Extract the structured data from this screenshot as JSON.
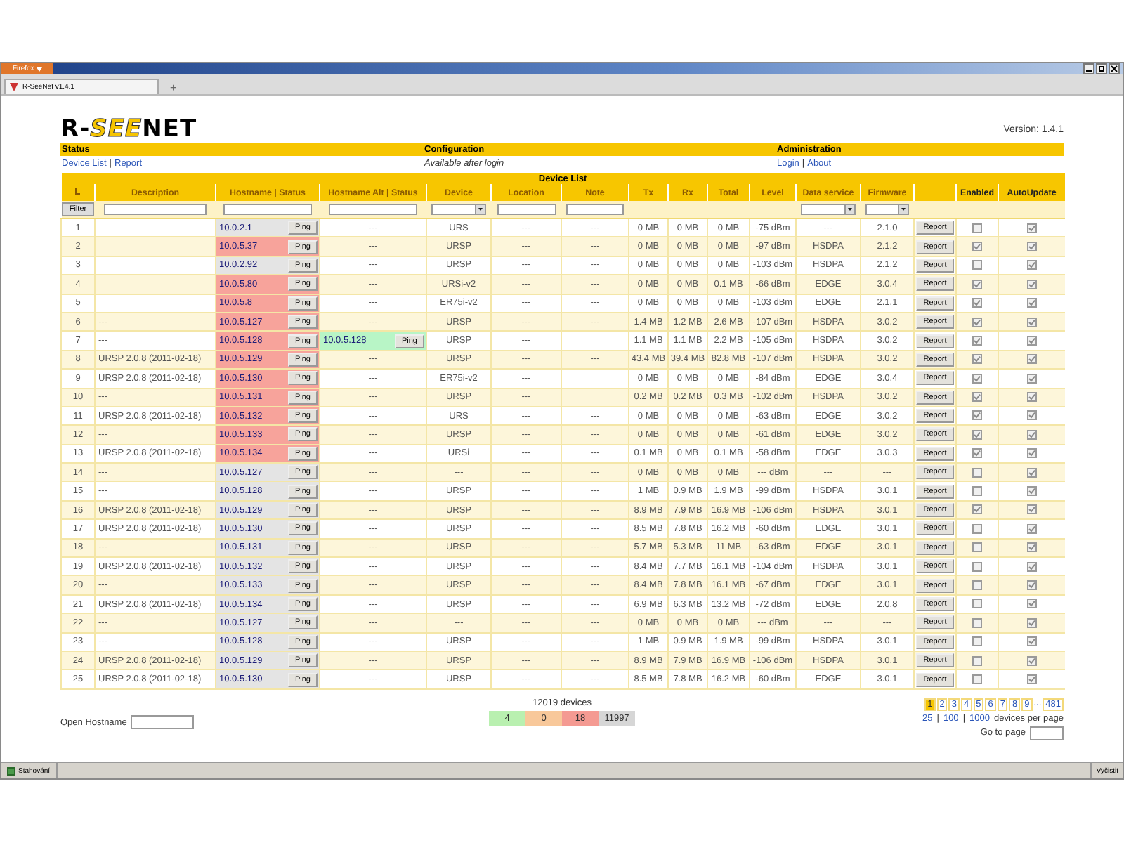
{
  "browser": {
    "menu_button": "Firefox",
    "tab_title": "R-SeeNet v1.4.1",
    "new_tab": "+"
  },
  "logo": {
    "prefix": "R-",
    "highlight": "SEE",
    "suffix": "NET"
  },
  "version": "Version: 1.4.1",
  "sections": [
    {
      "title": "Status",
      "links": [
        "Device List",
        "Report"
      ],
      "separators": [
        "|"
      ]
    },
    {
      "title": "Configuration",
      "note": "Available after login"
    },
    {
      "title": "Administration",
      "links": [
        "Login",
        "About"
      ],
      "separators": [
        "|"
      ]
    }
  ],
  "table_title": "Device List",
  "columns": [
    {
      "kind": "sort"
    },
    {
      "label": "Description"
    },
    {
      "label": "Hostname | Status"
    },
    {
      "label": "Hostname Alt | Status"
    },
    {
      "label": "Device"
    },
    {
      "label": "Location"
    },
    {
      "label": "Note"
    },
    {
      "label": "Tx"
    },
    {
      "label": "Rx"
    },
    {
      "label": "Total"
    },
    {
      "label": "Level"
    },
    {
      "label": "Data service"
    },
    {
      "label": "Firmware"
    },
    {
      "kind": "blank"
    },
    {
      "label": "Enabled"
    },
    {
      "label": "AutoUpdate"
    }
  ],
  "filters": [
    {
      "kind": "button",
      "label": "Filter"
    },
    {
      "kind": "input"
    },
    {
      "kind": "input"
    },
    {
      "kind": "input"
    },
    {
      "kind": "select"
    },
    {
      "kind": "input"
    },
    {
      "kind": "input"
    },
    {
      "kind": "empty"
    },
    {
      "kind": "empty"
    },
    {
      "kind": "empty"
    },
    {
      "kind": "empty"
    },
    {
      "kind": "select"
    },
    {
      "kind": "select"
    },
    {
      "kind": "empty"
    },
    {
      "kind": "empty"
    },
    {
      "kind": "empty"
    }
  ],
  "rows": [
    {
      "n": "1",
      "host": {
        "address": "10.0.2.1",
        "color": "#e4e4e4",
        "ping": "Ping"
      },
      "alt": {
        "text": "---"
      },
      "device": "URS",
      "location": "---",
      "note": "---",
      "tx": "0 MB",
      "rx": "0 MB",
      "total": "0 MB",
      "signal": "-75 dBm",
      "data_service": "---",
      "firmware": "2.1.0",
      "report": "Report",
      "enabled": false,
      "autoupdate": true
    },
    {
      "n": "2",
      "host": {
        "address": "10.0.5.37",
        "color": "#f7a39b",
        "ping": "Ping"
      },
      "alt": {
        "text": "---"
      },
      "device": "URSP",
      "location": "---",
      "note": "---",
      "tx": "0 MB",
      "rx": "0 MB",
      "total": "0 MB",
      "signal": "-97 dBm",
      "data_service": "HSDPA",
      "firmware": "2.1.2",
      "report": "Report",
      "enabled": true,
      "autoupdate": true
    },
    {
      "n": "3",
      "host": {
        "address": "10.0.2.92",
        "color": "#e4e4e4",
        "ping": "Ping"
      },
      "alt": {
        "text": "---"
      },
      "device": "URSP",
      "location": "---",
      "note": "---",
      "tx": "0 MB",
      "rx": "0 MB",
      "total": "0 MB",
      "signal": "-103 dBm",
      "data_service": "HSDPA",
      "firmware": "2.1.2",
      "report": "Report",
      "enabled": false,
      "autoupdate": true
    },
    {
      "n": "4",
      "host": {
        "address": "10.0.5.80",
        "color": "#f7a39b",
        "ping": "Ping"
      },
      "alt": {
        "text": "---"
      },
      "device": "URSi-v2",
      "location": "---",
      "note": "---",
      "tx": "0 MB",
      "rx": "0 MB",
      "total": "0.1 MB",
      "signal": "-66 dBm",
      "data_service": "EDGE",
      "firmware": "3.0.4",
      "report": "Report",
      "enabled": true,
      "autoupdate": true
    },
    {
      "n": "5",
      "host": {
        "address": "10.0.5.8",
        "color": "#f7a39b",
        "ping": "Ping"
      },
      "alt": {
        "text": "---"
      },
      "device": "ER75i-v2",
      "location": "---",
      "note": "---",
      "tx": "0 MB",
      "rx": "0 MB",
      "total": "0 MB",
      "signal": "-103 dBm",
      "data_service": "EDGE",
      "firmware": "2.1.1",
      "report": "Report",
      "enabled": true,
      "autoupdate": true
    },
    {
      "n": "6",
      "description": "---",
      "host": {
        "address": "10.0.5.127",
        "color": "#f7a39b",
        "ping": "Ping"
      },
      "alt": {
        "text": "---"
      },
      "device": "URSP",
      "location": "---",
      "note": "---",
      "tx": "1.4 MB",
      "rx": "1.2 MB",
      "total": "2.6 MB",
      "signal": "-107 dBm",
      "data_service": "HSDPA",
      "firmware": "3.0.2",
      "report": "Report",
      "enabled": true,
      "autoupdate": true
    },
    {
      "n": "7",
      "description": "---",
      "host": {
        "address": "10.0.5.128",
        "color": "#f7a39b",
        "ping": "Ping"
      },
      "alt": {
        "address": "10.0.5.128",
        "color": "#b8f5c6",
        "ping": "Ping"
      },
      "device": "URSP",
      "location": "---",
      "tx": "1.1 MB",
      "rx": "1.1 MB",
      "total": "2.2 MB",
      "signal": "-105 dBm",
      "data_service": "HSDPA",
      "firmware": "3.0.2",
      "report": "Report",
      "enabled": true,
      "autoupdate": true
    },
    {
      "n": "8",
      "description": "URSP 2.0.8 (2011-02-18)",
      "host": {
        "address": "10.0.5.129",
        "color": "#f7a39b",
        "ping": "Ping"
      },
      "alt": {
        "text": "---"
      },
      "device": "URSP",
      "location": "---",
      "note": "---",
      "tx": "43.4 MB",
      "rx": "39.4 MB",
      "total": "82.8 MB",
      "signal": "-107 dBm",
      "data_service": "HSDPA",
      "firmware": "3.0.2",
      "report": "Report",
      "enabled": true,
      "autoupdate": true
    },
    {
      "n": "9",
      "description": "URSP 2.0.8 (2011-02-18)",
      "host": {
        "address": "10.0.5.130",
        "color": "#f7a39b",
        "ping": "Ping"
      },
      "alt": {
        "text": "---"
      },
      "device": "ER75i-v2",
      "location": "---",
      "tx": "0 MB",
      "rx": "0 MB",
      "total": "0 MB",
      "signal": "-84 dBm",
      "data_service": "EDGE",
      "firmware": "3.0.4",
      "report": "Report",
      "enabled": true,
      "autoupdate": true
    },
    {
      "n": "10",
      "description": "---",
      "host": {
        "address": "10.0.5.131",
        "color": "#f7a39b",
        "ping": "Ping"
      },
      "alt": {
        "text": "---"
      },
      "device": "URSP",
      "location": "---",
      "tx": "0.2 MB",
      "rx": "0.2 MB",
      "total": "0.3 MB",
      "signal": "-102 dBm",
      "data_service": "HSDPA",
      "firmware": "3.0.2",
      "report": "Report",
      "enabled": true,
      "autoupdate": true
    },
    {
      "n": "11",
      "description": "URSP 2.0.8 (2011-02-18)",
      "host": {
        "address": "10.0.5.132",
        "color": "#f7a39b",
        "ping": "Ping"
      },
      "alt": {
        "text": "---"
      },
      "device": "URS",
      "location": "---",
      "note": "---",
      "tx": "0 MB",
      "rx": "0 MB",
      "total": "0 MB",
      "signal": "-63 dBm",
      "data_service": "EDGE",
      "firmware": "3.0.2",
      "report": "Report",
      "enabled": true,
      "autoupdate": true
    },
    {
      "n": "12",
      "description": "---",
      "host": {
        "address": "10.0.5.133",
        "color": "#f7a39b",
        "ping": "Ping"
      },
      "alt": {
        "text": "---"
      },
      "device": "URSP",
      "location": "---",
      "note": "---",
      "tx": "0 MB",
      "rx": "0 MB",
      "total": "0 MB",
      "signal": "-61 dBm",
      "data_service": "EDGE",
      "firmware": "3.0.2",
      "report": "Report",
      "enabled": true,
      "autoupdate": true
    },
    {
      "n": "13",
      "description": "URSP 2.0.8 (2011-02-18)",
      "host": {
        "address": "10.0.5.134",
        "color": "#f7a39b",
        "ping": "Ping"
      },
      "alt": {
        "text": "---"
      },
      "device": "URSi",
      "location": "---",
      "note": "---",
      "tx": "0.1 MB",
      "rx": "0 MB",
      "total": "0.1 MB",
      "signal": "-58 dBm",
      "data_service": "EDGE",
      "firmware": "3.0.3",
      "report": "Report",
      "enabled": true,
      "autoupdate": true
    },
    {
      "n": "14",
      "description": "---",
      "host": {
        "address": "10.0.5.127",
        "color": "#e4e4e4",
        "ping": "Ping"
      },
      "alt": {
        "text": "---"
      },
      "device": "---",
      "location": "---",
      "note": "---",
      "tx": "0 MB",
      "rx": "0 MB",
      "total": "0 MB",
      "signal": "--- dBm",
      "data_service": "---",
      "firmware": "---",
      "report": "Report",
      "enabled": false,
      "autoupdate": true
    },
    {
      "n": "15",
      "description": "---",
      "host": {
        "address": "10.0.5.128",
        "color": "#e4e4e4",
        "ping": "Ping"
      },
      "alt": {
        "text": "---"
      },
      "device": "URSP",
      "location": "---",
      "note": "---",
      "tx": "1 MB",
      "rx": "0.9 MB",
      "total": "1.9 MB",
      "signal": "-99 dBm",
      "data_service": "HSDPA",
      "firmware": "3.0.1",
      "report": "Report",
      "enabled": false,
      "autoupdate": true
    },
    {
      "n": "16",
      "description": "URSP 2.0.8 (2011-02-18)",
      "host": {
        "address": "10.0.5.129",
        "color": "#e4e4e4",
        "ping": "Ping"
      },
      "alt": {
        "text": "---"
      },
      "device": "URSP",
      "location": "---",
      "note": "---",
      "tx": "8.9 MB",
      "rx": "7.9 MB",
      "total": "16.9 MB",
      "signal": "-106 dBm",
      "data_service": "HSDPA",
      "firmware": "3.0.1",
      "report": "Report",
      "enabled": true,
      "autoupdate": true
    },
    {
      "n": "17",
      "description": "URSP 2.0.8 (2011-02-18)",
      "host": {
        "address": "10.0.5.130",
        "color": "#e4e4e4",
        "ping": "Ping"
      },
      "alt": {
        "text": "---"
      },
      "device": "URSP",
      "location": "---",
      "note": "---",
      "tx": "8.5 MB",
      "rx": "7.8 MB",
      "total": "16.2 MB",
      "signal": "-60 dBm",
      "data_service": "EDGE",
      "firmware": "3.0.1",
      "report": "Report",
      "enabled": false,
      "autoupdate": true
    },
    {
      "n": "18",
      "description": "---",
      "host": {
        "address": "10.0.5.131",
        "color": "#e4e4e4",
        "ping": "Ping"
      },
      "alt": {
        "text": "---"
      },
      "device": "URSP",
      "location": "---",
      "note": "---",
      "tx": "5.7 MB",
      "rx": "5.3 MB",
      "total": "11 MB",
      "signal": "-63 dBm",
      "data_service": "EDGE",
      "firmware": "3.0.1",
      "report": "Report",
      "enabled": false,
      "autoupdate": true
    },
    {
      "n": "19",
      "description": "URSP 2.0.8 (2011-02-18)",
      "host": {
        "address": "10.0.5.132",
        "color": "#e4e4e4",
        "ping": "Ping"
      },
      "alt": {
        "text": "---"
      },
      "device": "URSP",
      "location": "---",
      "note": "---",
      "tx": "8.4 MB",
      "rx": "7.7 MB",
      "total": "16.1 MB",
      "signal": "-104 dBm",
      "data_service": "HSDPA",
      "firmware": "3.0.1",
      "report": "Report",
      "enabled": false,
      "autoupdate": true
    },
    {
      "n": "20",
      "description": "---",
      "host": {
        "address": "10.0.5.133",
        "color": "#e4e4e4",
        "ping": "Ping"
      },
      "alt": {
        "text": "---"
      },
      "device": "URSP",
      "location": "---",
      "note": "---",
      "tx": "8.4 MB",
      "rx": "7.8 MB",
      "total": "16.1 MB",
      "signal": "-67 dBm",
      "data_service": "EDGE",
      "firmware": "3.0.1",
      "report": "Report",
      "enabled": false,
      "autoupdate": true
    },
    {
      "n": "21",
      "description": "URSP 2.0.8 (2011-02-18)",
      "host": {
        "address": "10.0.5.134",
        "color": "#e4e4e4",
        "ping": "Ping"
      },
      "alt": {
        "text": "---"
      },
      "device": "URSP",
      "location": "---",
      "note": "---",
      "tx": "6.9 MB",
      "rx": "6.3 MB",
      "total": "13.2 MB",
      "signal": "-72 dBm",
      "data_service": "EDGE",
      "firmware": "2.0.8",
      "report": "Report",
      "enabled": false,
      "autoupdate": true
    },
    {
      "n": "22",
      "description": "---",
      "host": {
        "address": "10.0.5.127",
        "color": "#e4e4e4",
        "ping": "Ping"
      },
      "alt": {
        "text": "---"
      },
      "device": "---",
      "location": "---",
      "note": "---",
      "tx": "0 MB",
      "rx": "0 MB",
      "total": "0 MB",
      "signal": "--- dBm",
      "data_service": "---",
      "firmware": "---",
      "report": "Report",
      "enabled": false,
      "autoupdate": true
    },
    {
      "n": "23",
      "description": "---",
      "host": {
        "address": "10.0.5.128",
        "color": "#e4e4e4",
        "ping": "Ping"
      },
      "alt": {
        "text": "---"
      },
      "device": "URSP",
      "location": "---",
      "note": "---",
      "tx": "1 MB",
      "rx": "0.9 MB",
      "total": "1.9 MB",
      "signal": "-99 dBm",
      "data_service": "HSDPA",
      "firmware": "3.0.1",
      "report": "Report",
      "enabled": false,
      "autoupdate": true
    },
    {
      "n": "24",
      "description": "URSP 2.0.8 (2011-02-18)",
      "host": {
        "address": "10.0.5.129",
        "color": "#e4e4e4",
        "ping": "Ping"
      },
      "alt": {
        "text": "---"
      },
      "device": "URSP",
      "location": "---",
      "note": "---",
      "tx": "8.9 MB",
      "rx": "7.9 MB",
      "total": "16.9 MB",
      "signal": "-106 dBm",
      "data_service": "HSDPA",
      "firmware": "3.0.1",
      "report": "Report",
      "enabled": false,
      "autoupdate": true
    },
    {
      "n": "25",
      "description": "URSP 2.0.8 (2011-02-18)",
      "host": {
        "address": "10.0.5.130",
        "color": "#e4e4e4",
        "ping": "Ping"
      },
      "alt": {
        "text": "---"
      },
      "device": "URSP",
      "location": "---",
      "note": "---",
      "tx": "8.5 MB",
      "rx": "7.8 MB",
      "total": "16.2 MB",
      "signal": "-60 dBm",
      "data_service": "EDGE",
      "firmware": "3.0.1",
      "report": "Report",
      "enabled": false,
      "autoupdate": true
    }
  ],
  "open_hostname": {
    "label": "Open Hostname"
  },
  "summary": {
    "total": "12019 devices",
    "counts": [
      {
        "value": "4",
        "color": "#b9f0b0"
      },
      {
        "value": "0",
        "color": "#f8c89a"
      },
      {
        "value": "18",
        "color": "#f49a92"
      },
      {
        "value": "11997",
        "color": "#d6d6d6"
      }
    ]
  },
  "pagination": {
    "pages": [
      {
        "label": "1",
        "selected": true
      },
      {
        "label": "2",
        "selected": false
      },
      {
        "label": "3",
        "selected": false
      },
      {
        "label": "4",
        "selected": false
      },
      {
        "label": "5",
        "selected": false
      },
      {
        "label": "6",
        "selected": false
      },
      {
        "label": "7",
        "selected": false
      },
      {
        "label": "8",
        "selected": false
      },
      {
        "label": "9",
        "selected": false
      },
      {
        "label": "...",
        "kind": "gap"
      },
      {
        "label": "481",
        "selected": false
      }
    ],
    "per_page": [
      "25",
      "100",
      "1000"
    ],
    "per_page_separators": [
      "|",
      "|"
    ],
    "per_page_label": "devices per page",
    "goto_label": "Go to page"
  },
  "status_bar": {
    "left": "Stahování",
    "right": "Vyčistit"
  }
}
